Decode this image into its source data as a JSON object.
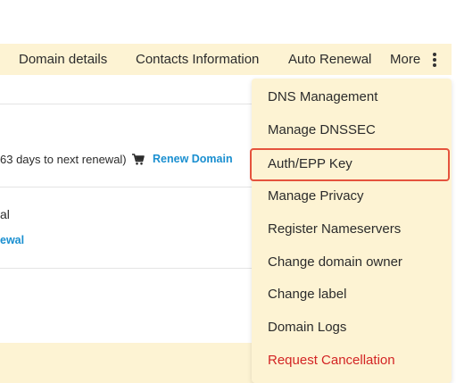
{
  "tabs": {
    "domain_details": "Domain details",
    "contacts_information": "Contacts Information",
    "auto_renewal": "Auto Renewal",
    "more": "More"
  },
  "rows": {
    "renewal_days_text": "63 days to next renewal)",
    "renew_domain_link": "Renew Domain",
    "auto_renewal_fragment": "al",
    "auto_renewal_link_fragment": "ewal"
  },
  "dropdown": {
    "items": [
      "DNS Management",
      "Manage DNSSEC",
      "Auth/EPP Key",
      "Manage Privacy",
      "Register Nameservers",
      "Change domain owner",
      "Change label",
      "Domain Logs",
      "Request Cancellation"
    ],
    "highlighted_index": 2,
    "danger_item_color": "#d32424",
    "highlight_border_color": "#e5533d"
  },
  "colors": {
    "tab_background": "#fdf3d3",
    "link": "#1a8fd0"
  },
  "icons": {
    "cart": "shopping-cart-icon",
    "more": "vertical-ellipsis-icon"
  }
}
